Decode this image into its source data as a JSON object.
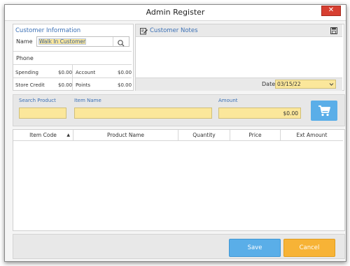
{
  "window": {
    "title": "Admin Register",
    "close_symbol": "✕"
  },
  "customer_info": {
    "heading": "Customer Information",
    "name_label": "Name",
    "name_value": "Walk In Customer",
    "phone_label": "Phone",
    "spending_label": "Spending",
    "spending_value": "$0.00",
    "account_label": "Account",
    "account_value": "$0.00",
    "store_credit_label": "Store Credit",
    "store_credit_value": "$0.00",
    "points_label": "Points",
    "points_value": "$0.00"
  },
  "customer_notes": {
    "heading": "Customer Notes",
    "date_label": "Date",
    "date_value": "03/15/22"
  },
  "product_entry": {
    "search_label": "Search Product",
    "item_name_label": "Item Name",
    "amount_label": "Amount",
    "amount_value": "$0.00"
  },
  "table": {
    "columns": [
      "Item Code",
      "Product Name",
      "Quantity",
      "Price",
      "Ext Amount"
    ],
    "sort_indicator": "▲"
  },
  "footer": {
    "save_label": "Save",
    "cancel_label": "Cancel"
  },
  "colors": {
    "accent": "#5aaee8",
    "cancel": "#f7b336",
    "field": "#fbe79b",
    "heading_blue": "#3b70b5"
  },
  "icons": [
    "magnifier-icon",
    "note-edit-icon",
    "save-disk-icon",
    "chevron-down-icon",
    "cart-icon",
    "sort-up-icon",
    "close-icon"
  ]
}
